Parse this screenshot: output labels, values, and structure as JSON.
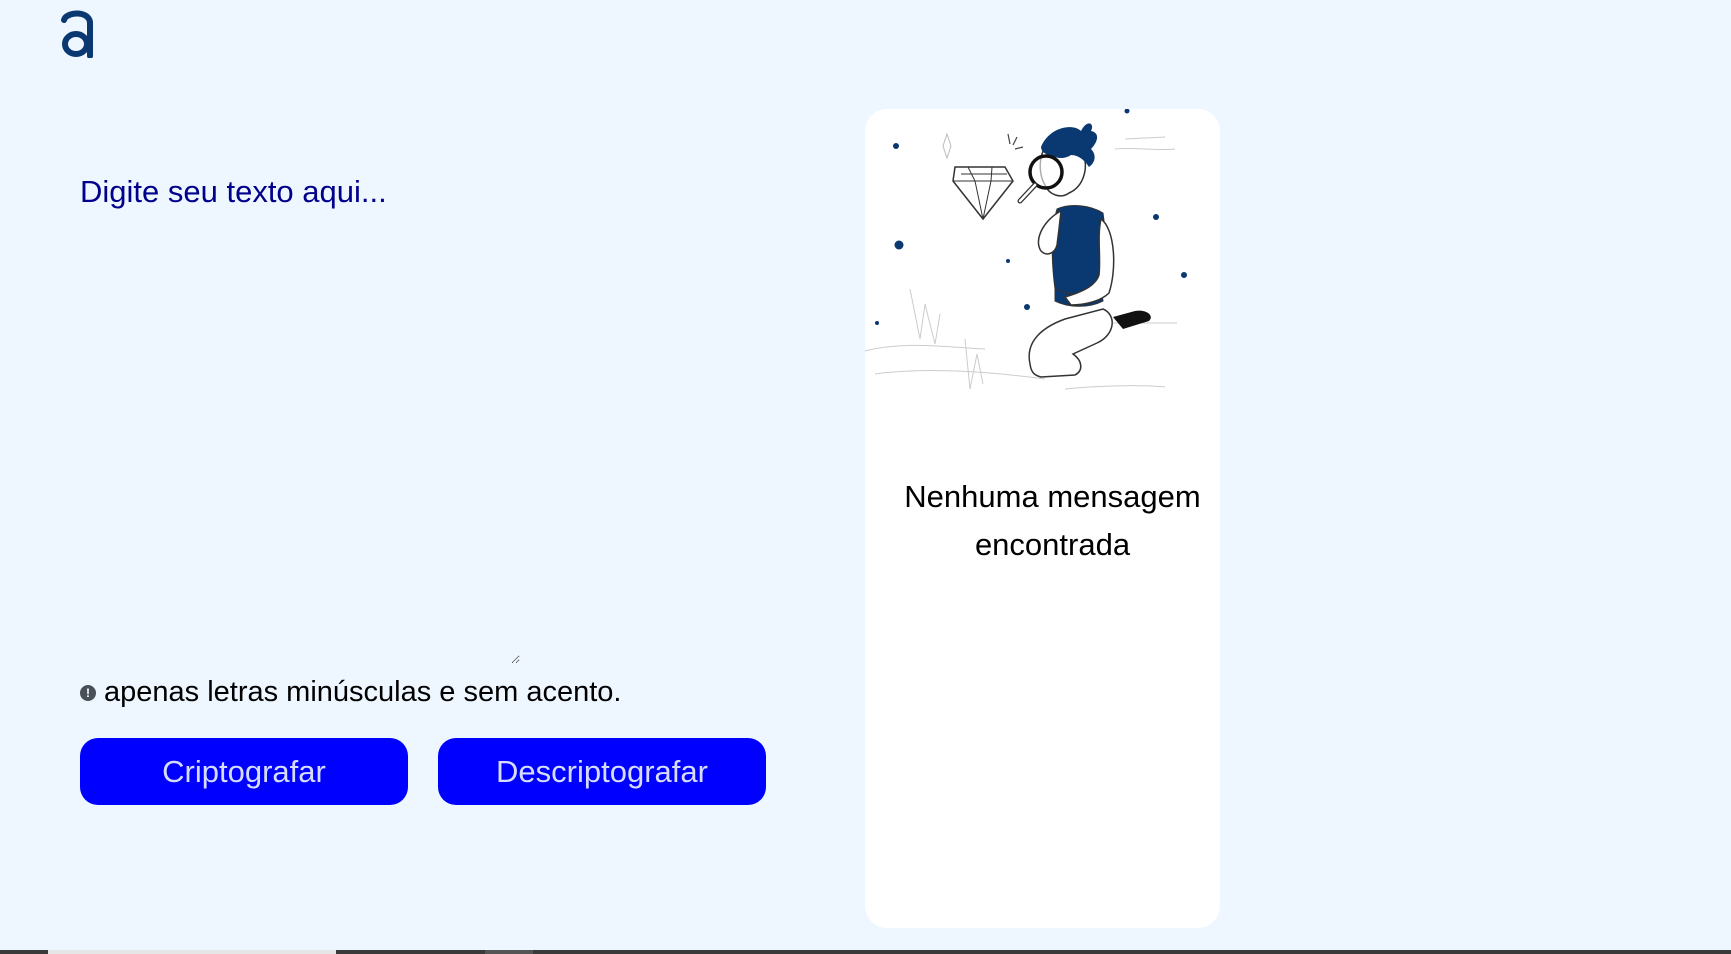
{
  "logo": {
    "icon": "alura-a-logo-icon",
    "color": "#0a3871"
  },
  "input": {
    "placeholder": "Digite seu texto aqui...",
    "value": ""
  },
  "hint": {
    "icon": "exclamation-circle-icon",
    "text": "apenas letras minúsculas e sem acento."
  },
  "buttons": {
    "encrypt_label": "Criptografar",
    "decrypt_label": "Descriptografar"
  },
  "output": {
    "illustration": "person-magnifying-glass-diamond-icon",
    "message": "Nenhuma mensagem encontrada"
  },
  "colors": {
    "background": "#eef6ff",
    "primary": "#0a3871",
    "button": "#0000ff",
    "card": "#ffffff"
  }
}
